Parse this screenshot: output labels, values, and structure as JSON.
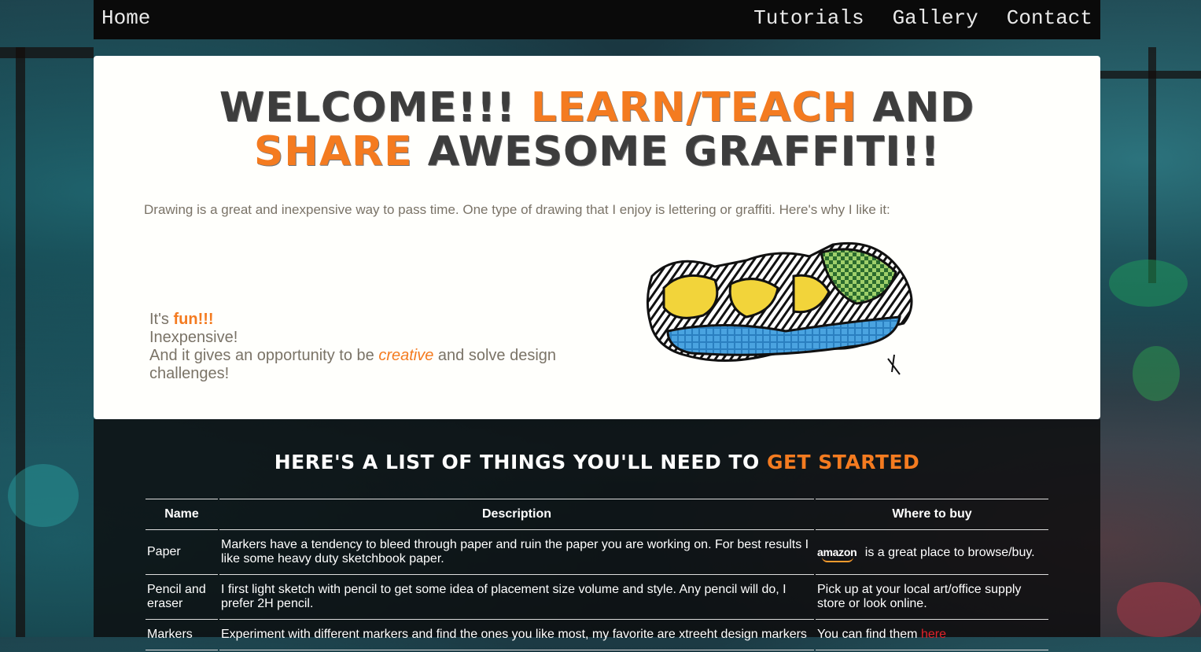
{
  "nav": {
    "home": "Home",
    "links": [
      "Tutorials",
      "Gallery",
      "Contact"
    ]
  },
  "hero": {
    "title_parts": [
      "Welcome!!! ",
      "Learn/Teach",
      " and ",
      "Share",
      " awesome graffiti!!"
    ],
    "intro": "Drawing is a great and inexpensive way to pass time. One type of drawing that I enjoy is lettering or graffiti. Here's why I like it:",
    "reasons": {
      "r1_prefix": "It's ",
      "r1_highlight": "fun!!!",
      "r2": "Inexpensive!",
      "r3_prefix": "And it gives an opportunity to be ",
      "r3_highlight": "creative",
      "r3_suffix": " and solve design challenges!"
    }
  },
  "supplies": {
    "title_prefix": "Here's a list of things you'll need to ",
    "title_highlight": "get started",
    "headers": [
      "Name",
      "Description",
      "Where to buy"
    ],
    "rows": [
      {
        "name": "Paper",
        "description": "Markers have a tendency to bleed through paper and ruin the paper you are working on. For best results I like some heavy duty sketchbook paper.",
        "logo": "amazon",
        "where": "is a great place to browse/buy."
      },
      {
        "name": "Pencil and eraser",
        "description": "I first light sketch with pencil to get some idea of placement size volume and style. Any pencil will do, I prefer 2H pencil.",
        "where": "Pick up at your local art/office supply store or look online."
      },
      {
        "name": "Markers",
        "description": "Experiment with different markers and find the ones you like most, my favorite are xtreeht design markers",
        "where_prefix": "You can find them ",
        "where_link": "here"
      }
    ]
  },
  "colors": {
    "accent": "#f47b20",
    "link_red": "#e0222a",
    "nav_bg": "#0a0a0a",
    "hero_bg": "#fffffc"
  }
}
